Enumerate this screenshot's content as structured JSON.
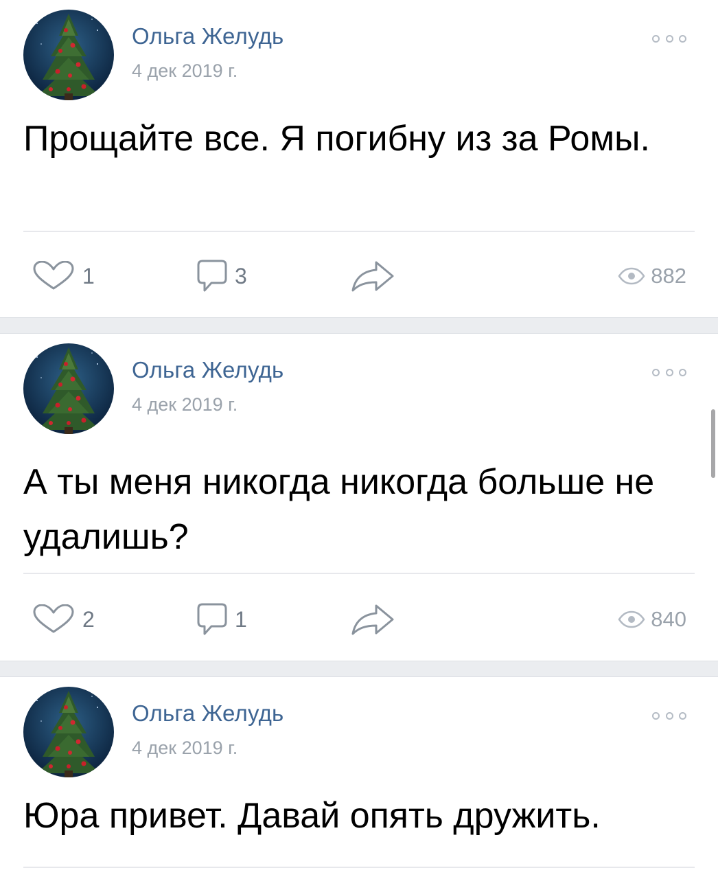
{
  "posts": [
    {
      "author": "Ольга Желудь",
      "date": "4 дек 2019 г.",
      "text": "Прощайте все. Я погибну из за Ромы.",
      "likes": "1",
      "comments": "3",
      "views": "882"
    },
    {
      "author": "Ольга Желудь",
      "date": "4 дек 2019 г.",
      "text": "А ты меня никогда никогда больше не удалишь?",
      "likes": "2",
      "comments": "1",
      "views": "840"
    },
    {
      "author": "Ольга Желудь",
      "date": "4 дек 2019 г.",
      "text": "Юра привет. Давай опять дружить."
    }
  ],
  "icons": {
    "avatar": "christmas-tree-avatar",
    "more": "more-horizontal-icon",
    "like": "heart-outline-icon",
    "comment": "comment-bubble-icon",
    "share": "share-arrow-icon",
    "views": "eye-icon"
  },
  "colors": {
    "author_link": "#3e6593",
    "secondary_text": "#9aa2ab",
    "action_icon": "#8a939d",
    "separator": "#ebedf0"
  }
}
